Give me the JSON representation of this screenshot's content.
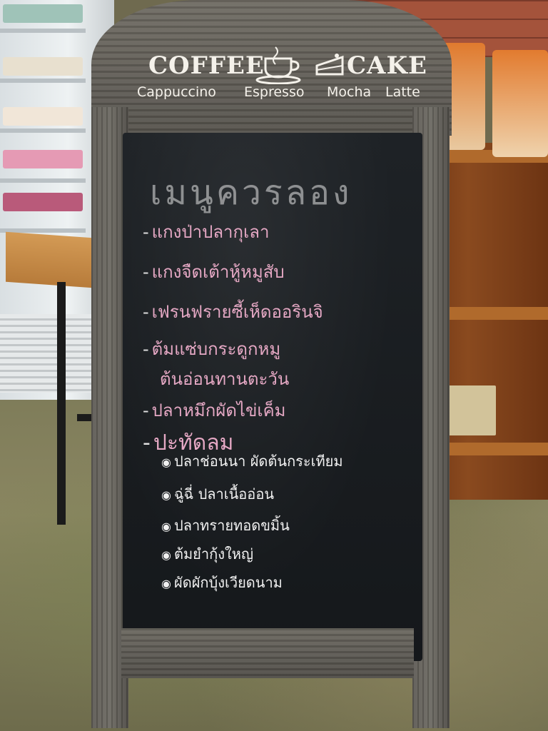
{
  "sign": {
    "brand_left": "COFFEE",
    "brand_right": "CAKE",
    "drinks": [
      "Cappuccino",
      "Espresso",
      "Mocha",
      "Latte"
    ]
  },
  "chalkboard": {
    "title": "เมนูควรลอง",
    "menu_items": [
      "แกงป่าปลากุเลา",
      "แกงจืดเต้าหู้หมูสับ",
      "เฟรนฟรายซี้เห็ดออรินจิ",
      "ต้มแซ่บกระดูกหมู",
      "ต้นอ่อนทานตะวัน",
      "ปลาหมึกผัดไข่เค็ม",
      "ปะทัดลม"
    ],
    "special_items": [
      "ปลาช่อนนา ผัดต้นกระเทียม",
      "ฉู่ฉี่ ปลาเนื้ออ่อน",
      "ปลาทรายทอดขมิ้น",
      "ต้มยำกุ้งใหญ่",
      "ผัดผักบุ้งเวียดนาม"
    ],
    "colors": {
      "board": "#1a1d20",
      "chalk_pink": "#e5a8c4",
      "chalk_white": "#f1f1f1"
    }
  },
  "icons": {
    "cup": "coffee-cup-icon",
    "cake": "cake-slice-icon"
  }
}
